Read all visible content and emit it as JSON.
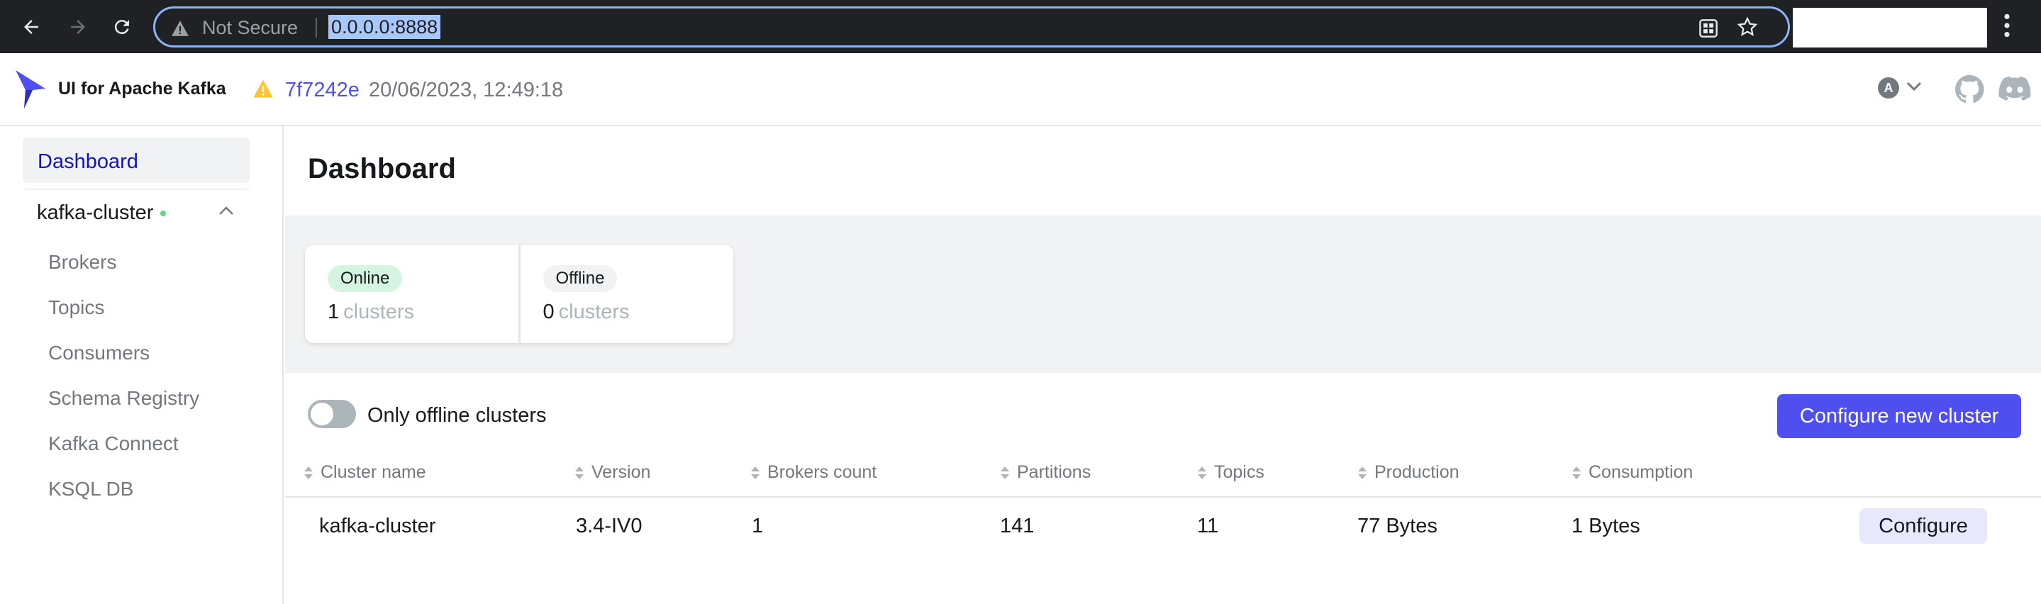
{
  "browser": {
    "security_label": "Not Secure",
    "url": "0.0.0.0:8888"
  },
  "header": {
    "app_name": "UI for Apache Kafka",
    "commit": "7f7242e",
    "build_date": "20/06/2023, 12:49:18",
    "user_initial": "A"
  },
  "sidebar": {
    "dashboard": "Dashboard",
    "cluster_name": "kafka-cluster",
    "items": [
      {
        "label": "Brokers"
      },
      {
        "label": "Topics"
      },
      {
        "label": "Consumers"
      },
      {
        "label": "Schema Registry"
      },
      {
        "label": "Kafka Connect"
      },
      {
        "label": "KSQL DB"
      }
    ]
  },
  "main": {
    "title": "Dashboard",
    "metrics": [
      {
        "tag": "Online",
        "value": "1",
        "unit": "clusters",
        "tag_color": "#d6f5e0"
      },
      {
        "tag": "Offline",
        "value": "0",
        "unit": "clusters",
        "tag_color": "#f1f2f3"
      }
    ],
    "toggle_label": "Only offline clusters",
    "toggle_on": false,
    "configure_new_label": "Configure new cluster",
    "table": {
      "columns": [
        "Cluster name",
        "Version",
        "Brokers count",
        "Partitions",
        "Topics",
        "Production",
        "Consumption"
      ],
      "rows": [
        {
          "cells": [
            "kafka-cluster",
            "3.4-IV0",
            "1",
            "141",
            "11",
            "77 Bytes",
            "1 Bytes"
          ],
          "action": "Configure"
        }
      ]
    }
  },
  "colors": {
    "accent": "#4f4ff0",
    "online_dot": "#5cd685",
    "warning": "#ffc433"
  }
}
